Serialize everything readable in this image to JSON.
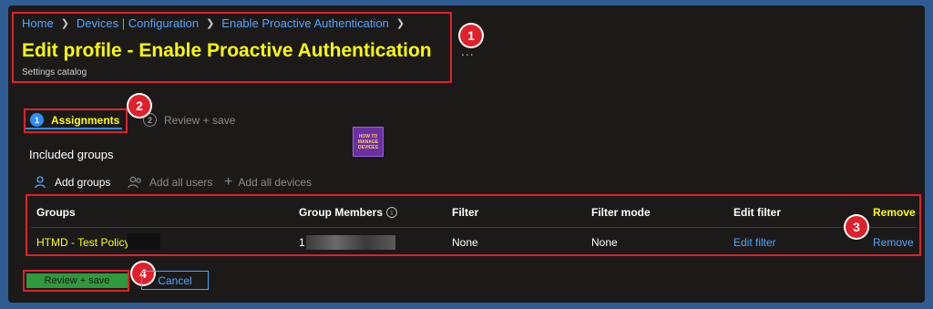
{
  "breadcrumb": [
    "Home",
    "Devices | Configuration",
    "Enable Proactive Authentication"
  ],
  "header": {
    "title": "Edit profile - Enable Proactive Authentication",
    "subtitle": "Settings catalog",
    "more": "..."
  },
  "steps": [
    {
      "number": "1",
      "label": "Assignments",
      "active": true
    },
    {
      "number": "2",
      "label": "Review + save",
      "active": false
    }
  ],
  "logo": {
    "lines": [
      "HOW TO",
      "MANAGE",
      "DEVICES"
    ]
  },
  "section_title": "Included groups",
  "actions": [
    {
      "label": "Add groups",
      "icon": "person-add-icon",
      "enabled": true
    },
    {
      "label": "Add all users",
      "icon": "people-icon",
      "enabled": false
    },
    {
      "label": "Add all devices",
      "icon": "plus-icon",
      "enabled": false
    }
  ],
  "table": {
    "columns": [
      "Groups",
      "Group Members",
      "Filter",
      "Filter mode",
      "Edit filter",
      "Remove"
    ],
    "rows": [
      {
        "group": "HTMD - Test Policy",
        "members": "1",
        "filter": "None",
        "filter_mode": "None",
        "edit_filter": "Edit filter",
        "remove": "Remove"
      }
    ]
  },
  "footer": {
    "primary": "Review + save",
    "secondary": "Cancel"
  },
  "callouts": [
    "1",
    "2",
    "3",
    "4"
  ],
  "colors": {
    "highlight": "#ffff00",
    "link": "#4da6ff",
    "annotation": "#e0202a",
    "primary_button": "#2e9a3c",
    "background": "#1b1a19"
  }
}
